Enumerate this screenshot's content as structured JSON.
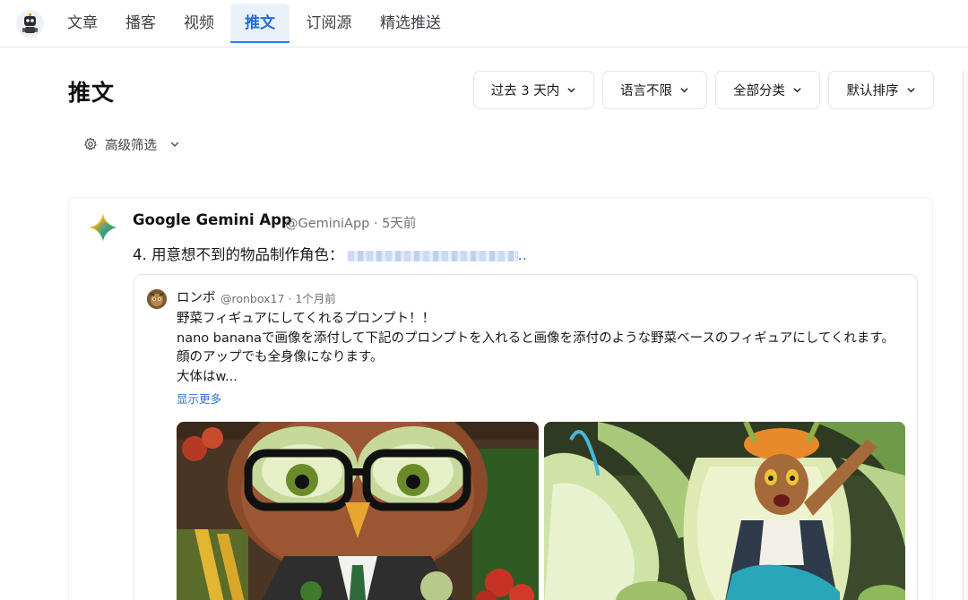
{
  "nav": {
    "tabs": [
      {
        "label": "文章",
        "active": false
      },
      {
        "label": "播客",
        "active": false
      },
      {
        "label": "视频",
        "active": false
      },
      {
        "label": "推文",
        "active": true
      },
      {
        "label": "订阅源",
        "active": false
      },
      {
        "label": "精选推送",
        "active": false
      }
    ]
  },
  "page": {
    "title": "推文",
    "filters": [
      {
        "label": "过去 3 天内"
      },
      {
        "label": "语言不限"
      },
      {
        "label": "全部分类"
      },
      {
        "label": "默认排序"
      }
    ],
    "advanced_filter_label": "高级筛选"
  },
  "tweet": {
    "author_name": "Google Gemini App",
    "author_meta": "@GeminiApp · 5天前",
    "text_prefix": "4. 用意想不到的物品制作角色：",
    "link_suffix": "..",
    "quote": {
      "name": "ロンボ",
      "meta": "@ronbox17 · 1个月前",
      "lines": [
        "野菜フィギュアにしてくれるプロンプト！！",
        "nano bananaで画像を添付して下記のプロンプトを入れると画像を添付のような野菜ベースのフィギュアにしてくれます。顔のアップでも全身像になります。",
        "大体はw..."
      ],
      "show_more": "显示更多"
    }
  },
  "colors": {
    "accent": "#1d6fe0",
    "active_tab_bg": "#eaf1fb",
    "link": "#2b6fd6"
  }
}
